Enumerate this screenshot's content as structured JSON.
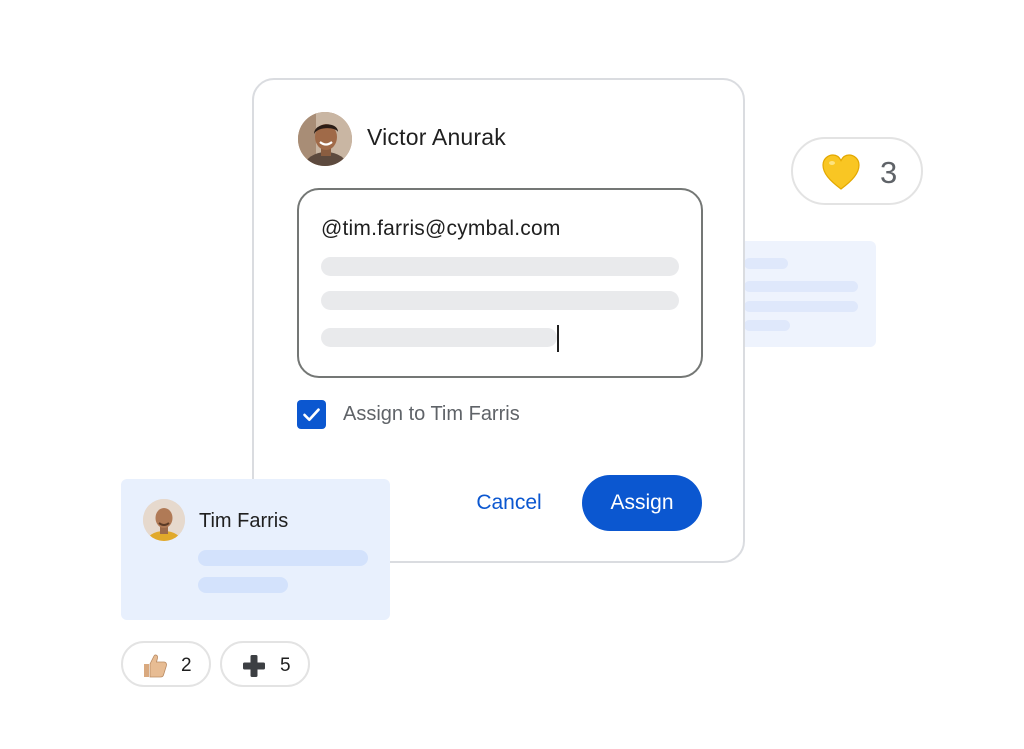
{
  "dialog": {
    "author_name": "Victor Anurak",
    "mention_text": "@tim.farris@cymbal.com",
    "assign_checkbox": {
      "label": "Assign to Tim Farris",
      "checked": true
    },
    "cancel_label": "Cancel",
    "assign_label": "Assign"
  },
  "assignee_card": {
    "name": "Tim Farris"
  },
  "reactions": {
    "heart": {
      "icon": "yellow-heart-icon",
      "count": "3"
    },
    "thumbs_up": {
      "icon": "thumbs-up-icon",
      "count": "2"
    },
    "plus": {
      "icon": "plus-icon",
      "count": "5"
    }
  },
  "colors": {
    "accent": "#0b57d0",
    "card_bg": "#e8f0fd",
    "placeholder": "#e9eaec"
  }
}
